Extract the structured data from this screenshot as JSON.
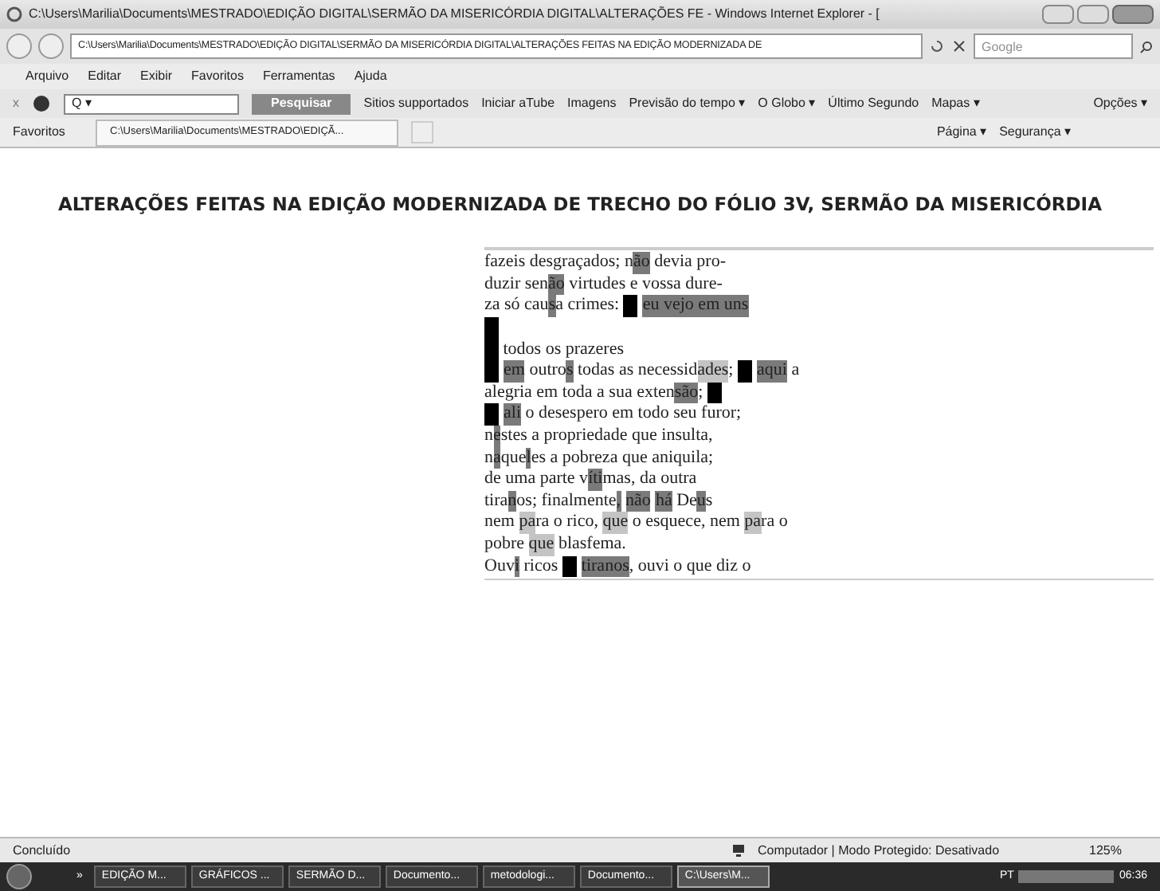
{
  "window": {
    "title": "C:\\Users\\Marilia\\Documents\\MESTRADO\\EDIÇÃO DIGITAL\\SERMÃO DA MISERICÓRDIA DIGITAL\\ALTERAÇÕES FE - Windows Internet Explorer - ["
  },
  "address": {
    "value": "C:\\Users\\Marilia\\Documents\\MESTRADO\\EDIÇÃO DIGITAL\\SERMÃO DA MISERICÓRDIA DIGITAL\\ALTERAÇÕES FEITAS NA EDIÇÃO MODERNIZADA DE"
  },
  "search": {
    "placeholder": "Google"
  },
  "menu": [
    "Arquivo",
    "Editar",
    "Exibir",
    "Favoritos",
    "Ferramentas",
    "Ajuda"
  ],
  "toolbar": {
    "close": "x",
    "search_button": "Pesquisar",
    "search_prefix": "Q ▾",
    "items": [
      "Sitios supportados",
      "Iniciar aTube",
      "Imagens",
      "Previsão do tempo ▾",
      "O Globo ▾",
      "Último Segundo",
      "Mapas ▾"
    ],
    "options": "Opções ▾"
  },
  "favorites": {
    "label": "Favoritos",
    "tab": "C:\\Users\\Marilia\\Documents\\MESTRADO\\EDIÇÃ...",
    "commands": [
      "Página ▾",
      "Segurança ▾"
    ]
  },
  "page": {
    "heading": "ALTERAÇÕES FEITAS NA EDIÇÃO MODERNIZADA DE TRECHO DO FÓLIO 3V, SERMÃO DA MISERICÓRDIA",
    "lines": [
      [
        {
          "kind": "plain",
          "text": "fazeis desgraçados; n"
        },
        {
          "kind": "dark",
          "text": "ão"
        },
        {
          "kind": "plain",
          "text": " devia pro-"
        }
      ],
      [
        {
          "kind": "plain",
          "text": "duzir sen"
        },
        {
          "kind": "dark",
          "text": "ão"
        },
        {
          "kind": "plain",
          "text": " virtudes e vossa dure-"
        }
      ],
      [
        {
          "kind": "plain",
          "text": "za só cau"
        },
        {
          "kind": "dark",
          "text": "s"
        },
        {
          "kind": "plain",
          "text": "a crimes: "
        },
        {
          "kind": "block"
        },
        {
          "kind": "dark",
          "text": "eu vejo em uns"
        }
      ],
      [
        {
          "kind": "block"
        }
      ],
      [
        {
          "kind": "block"
        },
        {
          "kind": "plain",
          "text": " todos os prazeres"
        }
      ],
      [
        {
          "kind": "block"
        },
        {
          "kind": "dark",
          "text": "em"
        },
        {
          "kind": "plain",
          "text": " outro"
        },
        {
          "kind": "dark",
          "text": "s"
        },
        {
          "kind": "plain",
          "text": " todas as necessid"
        },
        {
          "kind": "light",
          "text": "ades"
        },
        {
          "kind": "plain",
          "text": "; "
        },
        {
          "kind": "block"
        },
        {
          "kind": "dark",
          "text": "aqui"
        },
        {
          "kind": "plain",
          "text": " a"
        }
      ],
      [
        {
          "kind": "plain",
          "text": "alegria em toda a sua exten"
        },
        {
          "kind": "dark",
          "text": "são"
        },
        {
          "kind": "plain",
          "text": "; "
        },
        {
          "kind": "block"
        }
      ],
      [
        {
          "kind": "block"
        },
        {
          "kind": "dark",
          "text": "ali"
        },
        {
          "kind": "plain",
          "text": " o desespero em todo seu furor;"
        }
      ],
      [
        {
          "kind": "plain",
          "text": "n"
        },
        {
          "kind": "dark",
          "text": "e"
        },
        {
          "kind": "plain",
          "text": "stes a propriedade que insulta,"
        }
      ],
      [
        {
          "kind": "plain",
          "text": "n"
        },
        {
          "kind": "dark",
          "text": "a"
        },
        {
          "kind": "plain",
          "text": "que"
        },
        {
          "kind": "dark",
          "text": "l"
        },
        {
          "kind": "plain",
          "text": "es a pobreza que aniquila;"
        }
      ],
      [
        {
          "kind": "plain",
          "text": "de uma parte v"
        },
        {
          "kind": "dark",
          "text": "íti"
        },
        {
          "kind": "plain",
          "text": "mas, da outra"
        }
      ],
      [
        {
          "kind": "plain",
          "text": "tira"
        },
        {
          "kind": "dark",
          "text": "n"
        },
        {
          "kind": "plain",
          "text": "os; finalmente"
        },
        {
          "kind": "dark",
          "text": ","
        },
        {
          "kind": "dark",
          "text": "não"
        },
        {
          "kind": "dark",
          "text": "há"
        },
        {
          "kind": "plain",
          "text": " De"
        },
        {
          "kind": "dark",
          "text": "u"
        },
        {
          "kind": "plain",
          "text": "s"
        }
      ],
      [
        {
          "kind": "plain",
          "text": "nem "
        },
        {
          "kind": "light",
          "text": "pa"
        },
        {
          "kind": "plain",
          "text": "ra o rico, "
        },
        {
          "kind": "light",
          "text": "que"
        },
        {
          "kind": "plain",
          "text": " o esquece, nem "
        },
        {
          "kind": "light",
          "text": "pa"
        },
        {
          "kind": "plain",
          "text": "ra o"
        }
      ],
      [
        {
          "kind": "plain",
          "text": "pobre "
        },
        {
          "kind": "light",
          "text": "que"
        },
        {
          "kind": "plain",
          "text": " blasfema."
        }
      ],
      [
        {
          "kind": "plain",
          "text": "Ouv"
        },
        {
          "kind": "dark",
          "text": "i"
        },
        {
          "kind": "plain",
          "text": " ricos "
        },
        {
          "kind": "block"
        },
        {
          "kind": "dark",
          "text": "tiranos"
        },
        {
          "kind": "plain",
          "text": ", ouvi o que diz o"
        }
      ]
    ]
  },
  "status_bar": {
    "text": "Concluído",
    "zone": "Computador | Modo Protegido: Desativado",
    "zoom": "125%"
  },
  "taskbar": {
    "more": "»",
    "buttons": [
      {
        "label": "EDIÇÃO M...",
        "selected": false
      },
      {
        "label": "GRÁFICOS ...",
        "selected": false
      },
      {
        "label": "SERMÃO D...",
        "selected": false
      },
      {
        "label": "Documento...",
        "selected": false
      },
      {
        "label": "metodologi...",
        "selected": false
      },
      {
        "label": "Documento...",
        "selected": false
      },
      {
        "label": "C:\\Users\\M...",
        "selected": true
      }
    ],
    "language": "PT",
    "clock": "06:36"
  }
}
